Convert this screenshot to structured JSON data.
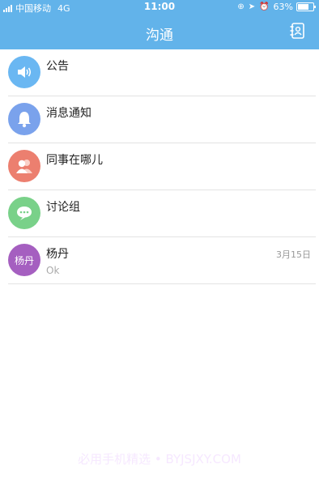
{
  "status_bar": {
    "carrier": "中国移动",
    "network": "4G",
    "time": "11:00",
    "battery": "63%",
    "battery_level": 0.63
  },
  "header": {
    "title": "沟通",
    "contacts_icon": "contacts-book-icon"
  },
  "colors": {
    "header": "#62b3ea",
    "announcement": "#6ab7f2",
    "notification": "#7aa2ec",
    "colleagues": "#ec7f6f",
    "discussion": "#79d189",
    "contact_avatar": "#a55fc0"
  },
  "items": [
    {
      "title": "公告",
      "icon": "speaker-icon"
    },
    {
      "title": "消息通知",
      "icon": "bell-icon"
    },
    {
      "title": "同事在哪儿",
      "icon": "people-icon"
    },
    {
      "title": "讨论组",
      "icon": "chat-bubble-icon"
    },
    {
      "title": "杨丹",
      "avatar_text": "杨丹",
      "preview": "Ok",
      "date": "3月15日"
    }
  ],
  "watermark": "必用手机精选 • BYJSJXY.COM"
}
